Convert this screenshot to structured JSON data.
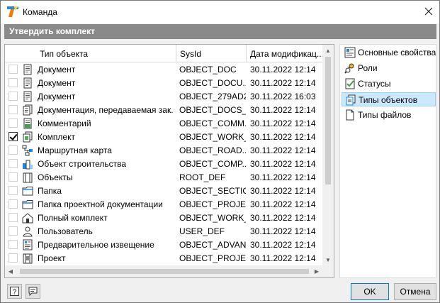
{
  "window": {
    "title": "Команда"
  },
  "section": {
    "title": "Утвердить комплект"
  },
  "grid": {
    "columns": [
      "Тип объекта",
      "SysId",
      "Дата модификац..."
    ],
    "rows": [
      {
        "checked": false,
        "icon": "document-icon",
        "type": "Документ",
        "sysid": "OBJECT_DOC",
        "date": "30.11.2022 12:14"
      },
      {
        "checked": false,
        "icon": "document-icon",
        "type": "Документ",
        "sysid": "OBJECT_DOCU...",
        "date": "30.11.2022 12:14"
      },
      {
        "checked": false,
        "icon": "document-icon",
        "type": "Документ",
        "sysid": "OBJECT_279AD2...",
        "date": "30.11.2022 16:03"
      },
      {
        "checked": false,
        "icon": "documentation-icon",
        "type": "Документация, передаваемая зак...",
        "sysid": "OBJECT_DOCS_...",
        "date": "30.11.2022 12:14"
      },
      {
        "checked": false,
        "icon": "comment-icon",
        "type": "Комментарий",
        "sysid": "OBJECT_COMM...",
        "date": "30.11.2022 12:14"
      },
      {
        "checked": true,
        "icon": "kit-icon",
        "type": "Комплект",
        "sysid": "OBJECT_WORK_...",
        "date": "30.11.2022 12:14"
      },
      {
        "checked": false,
        "icon": "route-map-icon",
        "type": "Маршрутная карта",
        "sysid": "OBJECT_ROAD...",
        "date": "30.11.2022 12:14"
      },
      {
        "checked": false,
        "icon": "building-object-icon",
        "type": "Объект строительства",
        "sysid": "OBJECT_COMP...",
        "date": "30.11.2022 12:14"
      },
      {
        "checked": false,
        "icon": "objects-icon",
        "type": "Объекты",
        "sysid": "ROOT_DEF",
        "date": "30.11.2022 12:14"
      },
      {
        "checked": false,
        "icon": "folder-icon",
        "type": "Папка",
        "sysid": "OBJECT_SECTION",
        "date": "30.11.2022 12:14"
      },
      {
        "checked": false,
        "icon": "folder-icon",
        "type": "Папка проектной документации",
        "sysid": "OBJECT_PROJE...",
        "date": "30.11.2022 12:14"
      },
      {
        "checked": false,
        "icon": "full-kit-icon",
        "type": "Полный комплект",
        "sysid": "OBJECT_WORK_...",
        "date": "30.11.2022 12:14"
      },
      {
        "checked": false,
        "icon": "user-icon",
        "type": "Пользователь",
        "sysid": "USER_DEF",
        "date": "30.11.2022 12:14"
      },
      {
        "checked": false,
        "icon": "notice-icon",
        "type": "Предварительное извещение",
        "sysid": "OBJECT_ADVAN...",
        "date": "30.11.2022 12:14"
      },
      {
        "checked": false,
        "icon": "project-icon",
        "type": "Проект",
        "sysid": "OBJECT_PROJECT",
        "date": "30.11.2022 12:14"
      }
    ]
  },
  "side": {
    "items": [
      {
        "label": "Основные свойства",
        "icon": "properties-icon",
        "selected": false
      },
      {
        "label": "Роли",
        "icon": "roles-icon",
        "selected": false
      },
      {
        "label": "Статусы",
        "icon": "statuses-icon",
        "selected": false
      },
      {
        "label": "Типы объектов",
        "icon": "object-types-icon",
        "selected": true
      },
      {
        "label": "Типы файлов",
        "icon": "file-types-icon",
        "selected": false
      }
    ]
  },
  "footer": {
    "ok_label": "OK",
    "cancel_label": "Отмена"
  },
  "colors": {
    "header_bg": "#8a8a8a",
    "selection_bg": "#cce8ff",
    "accent": "#0078d7"
  }
}
